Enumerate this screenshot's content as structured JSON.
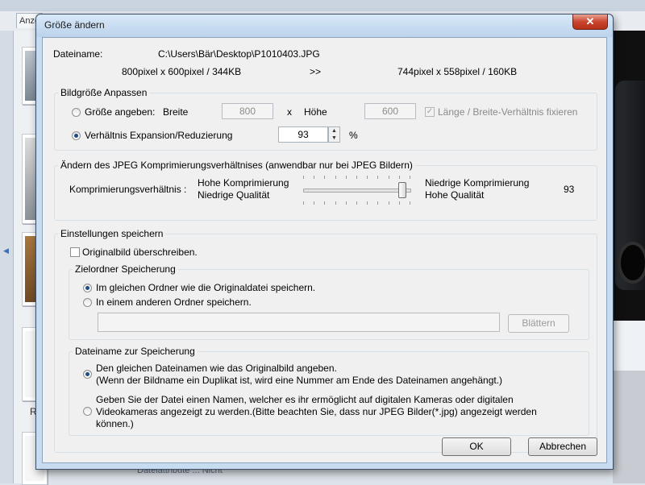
{
  "background": {
    "tab_label": "Anze",
    "left_char": "R",
    "bottom_text": "Dateiattribute ... Nicht"
  },
  "dialog": {
    "title": "Größe ändern",
    "close_glyph": "✕",
    "filename_label": "Dateiname:",
    "filename_value": "C:\\Users\\Bär\\Desktop\\P1010403.JPG",
    "original_size": "800pixel x 600pixel  /  344KB",
    "arrow": ">>",
    "new_size": "744pixel x 558pixel  /  160KB",
    "resize_group": {
      "legend": "Bildgröße Anpassen",
      "size_option_label": "Größe angeben:",
      "size_option_selected": false,
      "width_label": "Breite",
      "width_value": "800",
      "times": "x",
      "height_label": "Höhe",
      "height_value": "600",
      "keep_ratio_label": "Länge / Breite-Verhältnis fixieren",
      "keep_ratio_checked": true,
      "ratio_option_label": "Verhältnis Expansion/Reduzierung",
      "ratio_option_selected": true,
      "ratio_value": "93",
      "percent": "%"
    },
    "jpeg_group": {
      "legend": "Ändern des JPEG Komprimierungsverhältnises (anwendbar nur bei JPEG Bildern)",
      "ratio_label": "Komprimierungsverhältnis :",
      "high_comp": "Hohe Komprimierung",
      "low_quality": "Niedrige Qualität",
      "low_comp": "Niedrige Komprimierung",
      "high_quality": "Hohe Qualität",
      "value": "93",
      "slider_level": 0.93
    },
    "save_group": {
      "legend": "Einstellungen speichern",
      "overwrite_label": "Originalbild überschreiben.",
      "overwrite_checked": false,
      "folder_group": {
        "legend": "Zielordner Speicherung",
        "same_folder_label": "Im gleichen Ordner wie die Originaldatei speichern.",
        "same_folder_selected": true,
        "other_folder_label": "In einem anderen Ordner speichern.",
        "other_folder_selected": false,
        "path_value": "",
        "browse_label": "Blättern"
      },
      "name_group": {
        "legend": "Dateiname zur Speicherung",
        "same_name_line1": "Den gleichen Dateinamen wie das Originalbild angeben.",
        "same_name_line2": "(Wenn der Bildname ein Duplikat ist, wird eine Nummer am Ende des Dateinamen angehängt.)",
        "same_name_selected": true,
        "new_name_line1": "Geben Sie der Datei einen Namen, welcher es ihr ermöglicht auf digitalen Kameras oder digitalen",
        "new_name_line2": "Videokameras angezeigt zu werden.(Bitte beachten Sie, dass nur JPEG Bilder(*.jpg) angezeigt werden",
        "new_name_line3": "können.)",
        "new_name_selected": false
      }
    },
    "ok_label": "OK",
    "cancel_label": "Abbrechen"
  }
}
